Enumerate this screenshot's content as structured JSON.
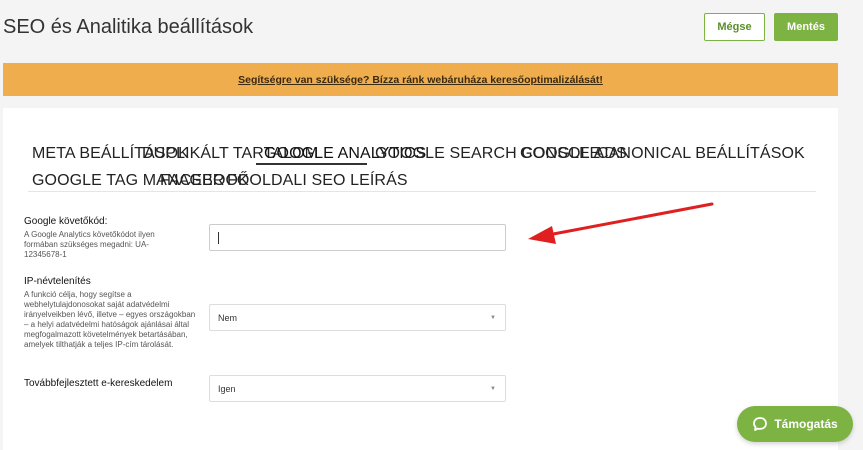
{
  "header": {
    "title": "SEO és Analitika beállítások",
    "cancel_label": "Mégse",
    "save_label": "Mentés"
  },
  "banner": {
    "text": "Segítségre van szüksége? Bízza ránk webáruháza keresőoptimalizálását!"
  },
  "tabs": [
    {
      "label": "META BEÁLLÍTÁSOK",
      "active": false
    },
    {
      "label": "DUPLIKÁLT TARTALOM",
      "active": false
    },
    {
      "label": "GOOGLE ANALYTICS",
      "active": true
    },
    {
      "label": "GOOGLE SEARCH CONSOLE",
      "active": false
    },
    {
      "label": "GOOGLE ADS",
      "active": false
    },
    {
      "label": "CANONICAL BEÁLLÍTÁSOK",
      "active": false
    },
    {
      "label": "GOOGLE TAG MANAGER",
      "active": false
    },
    {
      "label": "FACEBOOK",
      "active": false
    },
    {
      "label": "FŐOLDALI SEO LEÍRÁS",
      "active": false
    }
  ],
  "form": {
    "tracking_code": {
      "label": "Google követőkód:",
      "help": "A Google Analytics követőkódot ilyen formában szükséges megadni: UA-12345678-1",
      "value": ""
    },
    "ip_anonymization": {
      "label": "IP-névtelenítés",
      "help": "A funkció célja, hogy segítse a webhelytulajdonosokat saját adatvédelmi irányelveikben lévő, illetve – egyes országokban – a helyi adatvédelmi hatóságok ajánlásai által megfogalmazott követelmények betartásában, amelyek tilthatják a teljes IP-cím tárolását.",
      "value": "Nem"
    },
    "enhanced_ecommerce": {
      "label": "Továbbfejlesztett e-kereskedelem",
      "value": "Igen"
    }
  },
  "support": {
    "label": "Támogatás",
    "icon": "chat-bubble-icon"
  },
  "colors": {
    "accent_green": "#7cb342",
    "banner_orange": "#f0ad4e",
    "annotation_red": "#e02020"
  }
}
